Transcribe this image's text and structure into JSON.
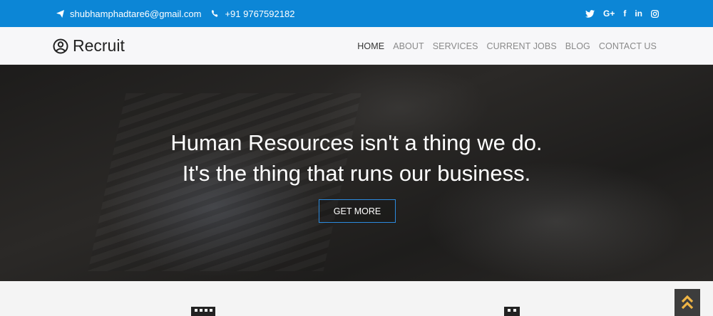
{
  "topbar": {
    "email": "shubhamphadtare6@gmail.com",
    "phone": "+91 9767592182",
    "social": [
      {
        "icon": "twitter-icon",
        "glyph": "t"
      },
      {
        "icon": "google-plus-icon",
        "glyph": "G+"
      },
      {
        "icon": "facebook-icon",
        "glyph": "f"
      },
      {
        "icon": "linkedin-icon",
        "glyph": "in"
      },
      {
        "icon": "instagram-icon",
        "glyph": ""
      }
    ],
    "background": "#0c86d6"
  },
  "navbar": {
    "brand": "Recruit",
    "items": [
      {
        "label": "HOME",
        "active": true
      },
      {
        "label": "ABOUT",
        "active": false
      },
      {
        "label": "SERVICES",
        "active": false
      },
      {
        "label": "CURRENT JOBS",
        "active": false
      },
      {
        "label": "BLOG",
        "active": false
      },
      {
        "label": "CONTACT US",
        "active": false
      }
    ]
  },
  "hero": {
    "line1": "Human Resources isn't a thing we do.",
    "line2": "It's the thing that runs our business.",
    "button": "GET MORE",
    "button_border": "#2b8be0"
  },
  "features": {
    "icons": [
      "building-icon",
      "building-icon"
    ]
  },
  "back_to_top": {
    "icon": "double-chevron-up-icon",
    "color": "#f0b545"
  }
}
